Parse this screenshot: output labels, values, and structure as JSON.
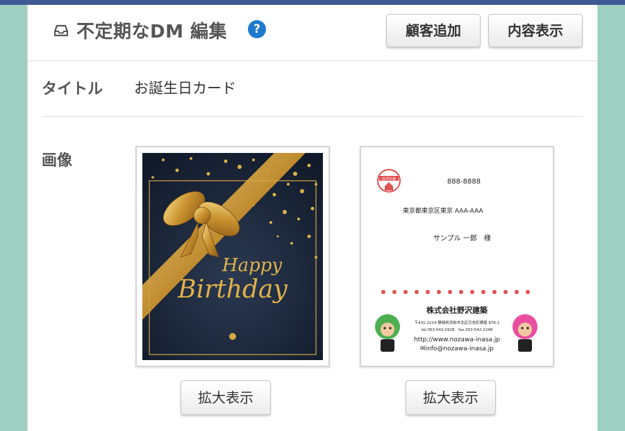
{
  "header": {
    "title": "不定期なDM 編集",
    "help_icon": "?",
    "add_customer_label": "顧客追加",
    "show_content_label": "内容表示"
  },
  "form": {
    "title_label": "タイトル",
    "title_value": "お誕生日カード",
    "image_label": "画像"
  },
  "images": [
    {
      "script_line1": "Happy",
      "script_line2": "Birthday",
      "zoom_label": "拡大表示"
    },
    {
      "postal_code": "888-8888",
      "address": "東京都東京区東京 AAA-AAA",
      "recipient": "サンプル 一郎　様",
      "logo_text": "前沢の家",
      "company_name": "株式会社野沢建築",
      "company_address": "〒431-2214 静岡県浜松市北区引佐町横尾 876-1",
      "tel_fax": "tel.053-542-0328　fax.053-542-2248",
      "url": "http://www.nozawa-inasa.jp",
      "email": "✉info@nozawa-inasa.jp",
      "zoom_label": "拡大表示"
    }
  ],
  "colors": {
    "background": "#9dd0c0",
    "top_bar": "#3f5a95",
    "help_icon": "#1f7acc"
  }
}
